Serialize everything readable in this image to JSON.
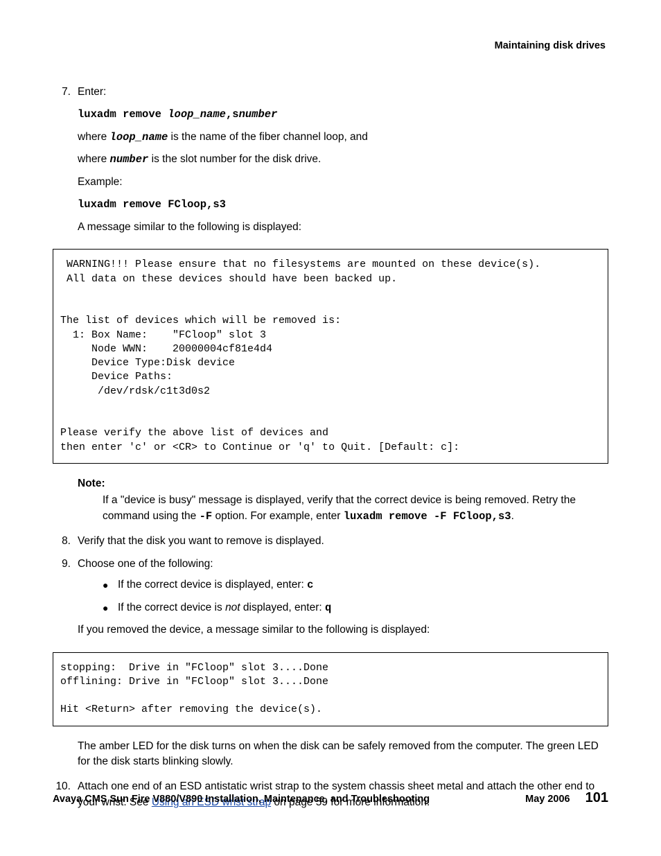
{
  "running_head": "Maintaining disk drives",
  "step7": {
    "num": "7.",
    "label": "Enter:",
    "cmd_prefix": "luxadm remove ",
    "cmd_arg1": "loop_name",
    "cmd_sep": ",s",
    "cmd_arg2": "number",
    "where1_a": "where ",
    "where1_var": "loop_name",
    "where1_b": " is the name of the fiber channel loop, and",
    "where2_a": "where ",
    "where2_var": "number",
    "where2_b": " is the slot number for the disk drive.",
    "example_label": "Example:",
    "example_cmd": "luxadm remove FCloop,s3",
    "msg_intro": "A message similar to the following is displayed:"
  },
  "codebox1": " WARNING!!! Please ensure that no filesystems are mounted on these device(s).\n All data on these devices should have been backed up.\n\n\nThe list of devices which will be removed is:\n  1: Box Name:    \"FCloop\" slot 3\n     Node WWN:    20000004cf81e4d4\n     Device Type:Disk device\n     Device Paths:\n      /dev/rdsk/c1t3d0s2\n\n\nPlease verify the above list of devices and\nthen enter 'c' or <CR> to Continue or 'q' to Quit. [Default: c]:",
  "note": {
    "label": "Note:",
    "body_a": "If a \"device is busy\" message is displayed, verify that the correct device is being removed. Retry the command using the ",
    "opt": "-F",
    "body_b": " option. For example, enter ",
    "cmd": "luxadm remove -F FCloop,s3",
    "body_c": "."
  },
  "step8": {
    "num": "8.",
    "text": "Verify that the disk you want to remove is displayed."
  },
  "step9": {
    "num": "9.",
    "text": "Choose one of the following:",
    "b1_a": "If the correct device is displayed, enter: ",
    "b1_cmd": "c",
    "b2_a": "If the correct device is ",
    "b2_not": "not",
    "b2_b": " displayed, enter: ",
    "b2_cmd": "q",
    "after": "If you removed the device, a message similar to the following is displayed:"
  },
  "codebox2": "stopping:  Drive in \"FCloop\" slot 3....Done\noffliniing: Drive in \"FCloop\" slot 3....Done\n\nHit <Return> after removing the device(s).",
  "codebox2_fixed": "stopping:  Drive in \"FCloop\" slot 3....Done\nofflining: Drive in \"FCloop\" slot 3....Done\n\nHit <Return> after removing the device(s).",
  "led_para": "The amber LED for the disk turns on when the disk can be safely removed from the computer. The green LED for the disk starts blinking slowly.",
  "step10": {
    "num": "10.",
    "a": "Attach one end of an ESD antistatic wrist strap to the system chassis sheet metal and attach the other end to your wrist. See ",
    "link": "Using an ESD wrist strap",
    "b": " on page 59 for more information."
  },
  "footer": {
    "left": "Avaya CMS Sun Fire V880/V890 Installation, Maintenance, and Troubleshooting",
    "date": "May 2006",
    "page": "101"
  }
}
